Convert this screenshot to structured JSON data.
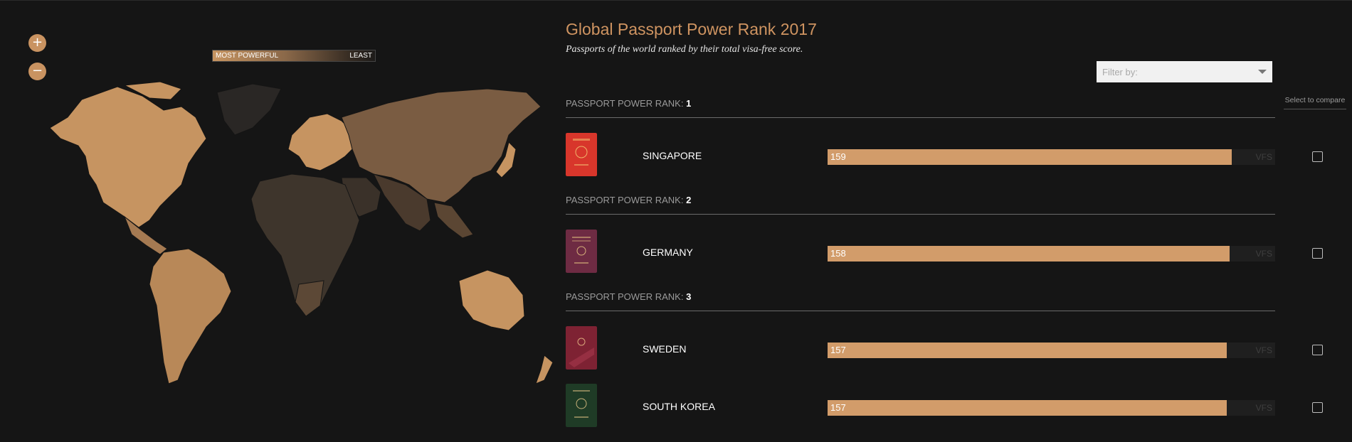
{
  "controls": {
    "zoom_in": "+",
    "zoom_out": "−"
  },
  "legend": {
    "most": "MOST POWERFUL",
    "least": "LEAST"
  },
  "header": {
    "title": "Global Passport Power Rank 2017",
    "subtitle": "Passports of the world ranked by their total visa-free score."
  },
  "filter": {
    "placeholder": "Filter by:"
  },
  "compare": {
    "label": "Select to compare"
  },
  "rank_prefix": "PASSPORT POWER RANK:",
  "vfs_label": "VFS",
  "max_score": 176,
  "colors": {
    "accent": "#cf9461",
    "bar": "#d29c6a",
    "background": "#151515",
    "singapore_passport": "#d8362b",
    "germany_passport": "#6e2b43",
    "sweden_passport": "#7e2233",
    "korea_passport": "#1f3b26"
  },
  "ranks": [
    {
      "rank": "1",
      "countries": [
        {
          "name": "SINGAPORE",
          "score": 159,
          "cover_icon": "passport-singapore-icon",
          "color": "#d8362b"
        }
      ]
    },
    {
      "rank": "2",
      "countries": [
        {
          "name": "GERMANY",
          "score": 158,
          "cover_icon": "passport-germany-icon",
          "color": "#6e2b43"
        }
      ]
    },
    {
      "rank": "3",
      "countries": [
        {
          "name": "SWEDEN",
          "score": 157,
          "cover_icon": "passport-sweden-icon",
          "color": "#7e2233"
        },
        {
          "name": "SOUTH KOREA",
          "score": 157,
          "cover_icon": "passport-south-korea-icon",
          "color": "#1f3b26"
        }
      ]
    }
  ]
}
